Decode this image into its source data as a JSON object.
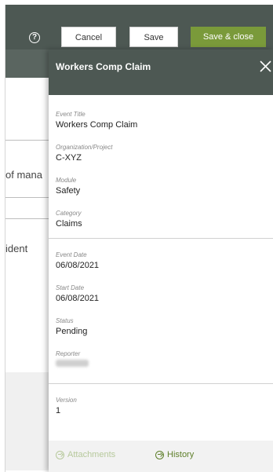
{
  "toolbar": {
    "help_icon": "?",
    "cancel_label": "Cancel",
    "save_label": "Save",
    "save_close_label": "Save & close",
    "save_close_color": "#7a9a3a"
  },
  "background": {
    "row1_text": "of mana",
    "row2_text": "ident"
  },
  "panel": {
    "title": "Workers Comp Claim",
    "close_icon": "close-icon",
    "fields": {
      "event_title": {
        "label": "Event Title",
        "value": "Workers Comp Claim"
      },
      "organization": {
        "label": "Organization/Project",
        "value": "C-XYZ"
      },
      "module": {
        "label": "Module",
        "value": "Safety"
      },
      "category": {
        "label": "Category",
        "value": "Claims"
      },
      "event_date": {
        "label": "Event Date",
        "value": "06/08/2021"
      },
      "start_date": {
        "label": "Start Date",
        "value": "06/08/2021"
      },
      "status": {
        "label": "Status",
        "value": "Pending"
      },
      "reporter": {
        "label": "Reporter"
      },
      "version": {
        "label": "Version",
        "value": "1"
      }
    },
    "footer": {
      "attachments_label": "Attachments",
      "history_label": "History"
    }
  }
}
